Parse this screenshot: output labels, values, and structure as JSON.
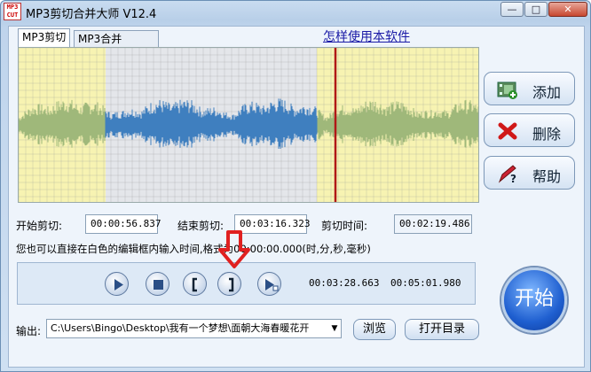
{
  "window": {
    "title": "MP3剪切合并大师 V12.4",
    "icon_text": "MP3\nCUT"
  },
  "title_buttons": {
    "minimize": "—",
    "maximize": "□",
    "close": "✕"
  },
  "tabs": [
    {
      "label": "MP3剪切"
    },
    {
      "label": "MP3合并"
    }
  ],
  "help_link": "怎样使用本软件",
  "side_buttons": {
    "add": {
      "label": "添加",
      "icon": "add-film-icon"
    },
    "delete": {
      "label": "删除",
      "icon": "red-x-icon"
    },
    "help": {
      "label": "帮助",
      "icon": "help-pencil-icon"
    }
  },
  "cut": {
    "start_label": "开始剪切:",
    "start_value": "00:00:56.837",
    "end_label": "结束剪切:",
    "end_value": "00:03:16.323",
    "duration_label": "剪切时间:",
    "duration_value": "00:02:19.486"
  },
  "hint": "您也可以直接在白色的编辑框内输入时间,格式为00:00:00.000(时,分,秒,毫秒)",
  "playback": {
    "buttons": [
      "play-icon",
      "stop-icon",
      "mark-start-icon",
      "mark-end-icon",
      "play-selection-icon"
    ],
    "current_time": "00:03:28.663",
    "total_time": "00:05:01.980"
  },
  "start_button": "开始",
  "output": {
    "label": "输出:",
    "path": "C:\\Users\\Bingo\\Desktop\\我有一个梦想\\面朝大海春暖花开",
    "browse": "浏览",
    "open_dir": "打开目录"
  },
  "colors": {
    "waveform_selected": "#3f7fbf",
    "waveform_unselected": "#9fb87a",
    "playhead": "#b01818",
    "accent_arrow": "#e02020"
  }
}
